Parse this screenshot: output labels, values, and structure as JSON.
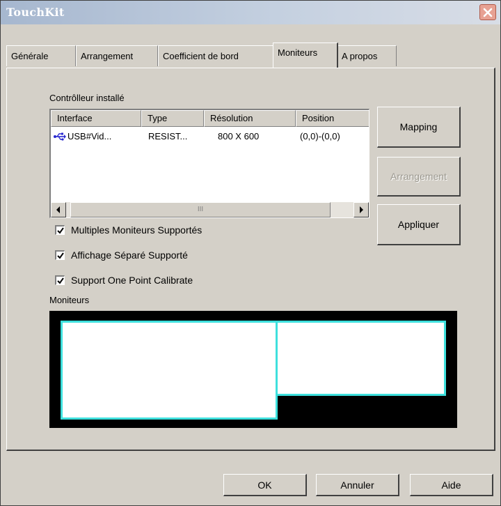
{
  "window": {
    "title": "TouchKit"
  },
  "tabs": [
    {
      "label": "Générale"
    },
    {
      "label": "Arrangement"
    },
    {
      "label": "Coefficient de bord"
    },
    {
      "label": "Moniteurs"
    },
    {
      "label": "A propos"
    }
  ],
  "active_tab": "Moniteurs",
  "controller": {
    "label": "Contrôlleur installé",
    "columns": [
      "Interface",
      "Type",
      "Résolution",
      "Position"
    ],
    "rows": [
      {
        "interface": "USB#Vid...",
        "type": "RESIST...",
        "resolution": "800 X 600",
        "position": "(0,0)-(0,0)"
      }
    ],
    "scroll_thumb_grip": "III"
  },
  "buttons": {
    "mapping": "Mapping",
    "arrangement": "Arrangement",
    "apply": "Appliquer"
  },
  "checkboxes": [
    {
      "label": "Multiples Moniteurs Supportés",
      "checked": true
    },
    {
      "label": "Affichage Séparé Supporté",
      "checked": true
    },
    {
      "label": "Support One Point Calibrate",
      "checked": true
    }
  ],
  "monitors": {
    "label": "Moniteurs",
    "count": 2,
    "border_color": "#3ee0dd",
    "background_color": "#000000"
  },
  "footer": {
    "ok": "OK",
    "cancel": "Annuler",
    "help": "Aide"
  },
  "icons": {
    "close": "close-icon",
    "usb": "usb-icon",
    "scroll_left": "arrow-left-icon",
    "scroll_right": "arrow-right-icon",
    "check": "checkmark-icon"
  }
}
